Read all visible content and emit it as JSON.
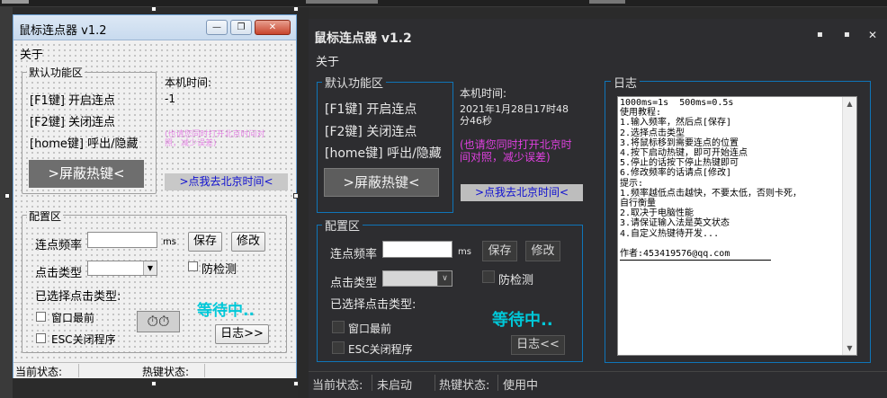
{
  "colors": {
    "accent_cyan": "#00c8d8",
    "pink": "#e040e0",
    "link_blue": "#1010d0",
    "dark_bg": "#2d2d30",
    "group_border": "#0f75b8"
  },
  "light": {
    "title": "鼠标连点器 v1.2",
    "controls": {
      "min": "—",
      "max": "❐",
      "close": "✕"
    },
    "menu_about": "关于",
    "default_group": "默认功能区",
    "hotkeys": [
      "[F1键] 开启连点",
      "[F2键] 关闭连点",
      "[home键] 呼出/隐藏"
    ],
    "time_label": "本机时间:",
    "time_value": "-1",
    "hint": "(也请您同时打开北京时间对照，减少误差)",
    "shield_button": ">屏蔽热键<",
    "beijing_link": ">点我去北京时间<",
    "config_group": "配置区",
    "freq_label": "连点频率",
    "freq_unit": "ms",
    "save_button": "保存",
    "modify_button": "修改",
    "click_type_label": "点击类型",
    "anti_detect": "防检测",
    "selected_type_label": "已选择点击类型:",
    "topmost": "窗口最前",
    "esc_close": "ESC关闭程序",
    "waiting": "等待中..",
    "log_button": "日志>>",
    "status_label": "当前状态:",
    "hotkey_status_label": "热键状态:"
  },
  "dark": {
    "title": "鼠标连点器 v1.2",
    "controls": {
      "min": "▪",
      "max": "▪",
      "close": "✕"
    },
    "menu_about": "关于",
    "default_group": "默认功能区",
    "hotkeys": [
      "[F1键] 开启连点",
      "[F2键] 关闭连点",
      "[home键] 呼出/隐藏"
    ],
    "time_label": "本机时间:",
    "time_value": "2021年1月28日17时48分46秒",
    "hint": "(也请您同时打开北京时间对照，减少误差)",
    "shield_button": ">屏蔽热键<",
    "beijing_link": ">点我去北京时间<",
    "config_group": "配置区",
    "freq_label": "连点频率",
    "freq_unit": "ms",
    "save_button": "保存",
    "modify_button": "修改",
    "click_type_label": "点击类型",
    "anti_detect": "防检测",
    "selected_type_label": "已选择点击类型:",
    "topmost": "窗口最前",
    "esc_close": "ESC关闭程序",
    "waiting": "等待中..",
    "log_button": "日志<<",
    "log_group": "日志",
    "log_lines": [
      "1000ms=1s  500ms=0.5s",
      "使用教程:",
      "1.输入频率，然后点[保存]",
      "2.选择点击类型",
      "3.将鼠标移到需要连点的位置",
      "4.按下启动热键，即可开始连点",
      "5.停止的话按下停止热键即可",
      "6.修改频率的话请点[修改]",
      "提示:",
      "1.频率越低点击越快，不要太低，否则卡死，",
      "自行衡量",
      "2.取决于电脑性能",
      "3.请保证输入法是英文状态",
      "4.自定义热键待开发...",
      "",
      "作者:453419576@qq.com"
    ],
    "status_label": "当前状态:",
    "status_value": "未启动",
    "hotkey_status_label": "热键状态:",
    "hotkey_status_value": "使用中"
  }
}
